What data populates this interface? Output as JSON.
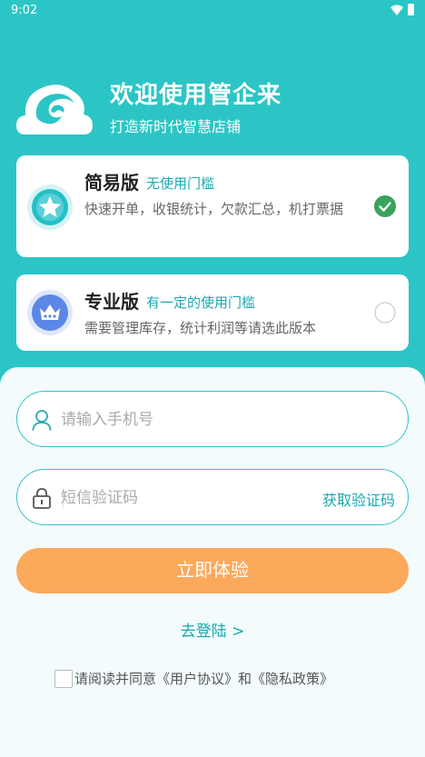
{
  "status": {
    "time": "9:02"
  },
  "brand": {
    "title": "欢迎使用管企来",
    "subtitle": "打造新时代智慧店铺"
  },
  "plans": [
    {
      "name": "简易版",
      "tag": "无使用门槛",
      "desc": "快速开单，收银统计，欠款汇总，机打票据",
      "selected": true
    },
    {
      "name": "专业版",
      "tag": "有一定的使用门槛",
      "desc": "需要管理库存，统计利润等请选此版本",
      "selected": false
    }
  ],
  "form": {
    "phone_placeholder": "请输入手机号",
    "code_placeholder": "短信验证码",
    "get_code": "获取验证码",
    "submit": "立即体验",
    "login_link": "去登陆 >"
  },
  "agreement": {
    "text": "请阅读并同意《用户协议》和《隐私政策》"
  },
  "colors": {
    "primary": "#2cc5c6",
    "accent": "#fca95c",
    "link": "#1aa9b3"
  }
}
